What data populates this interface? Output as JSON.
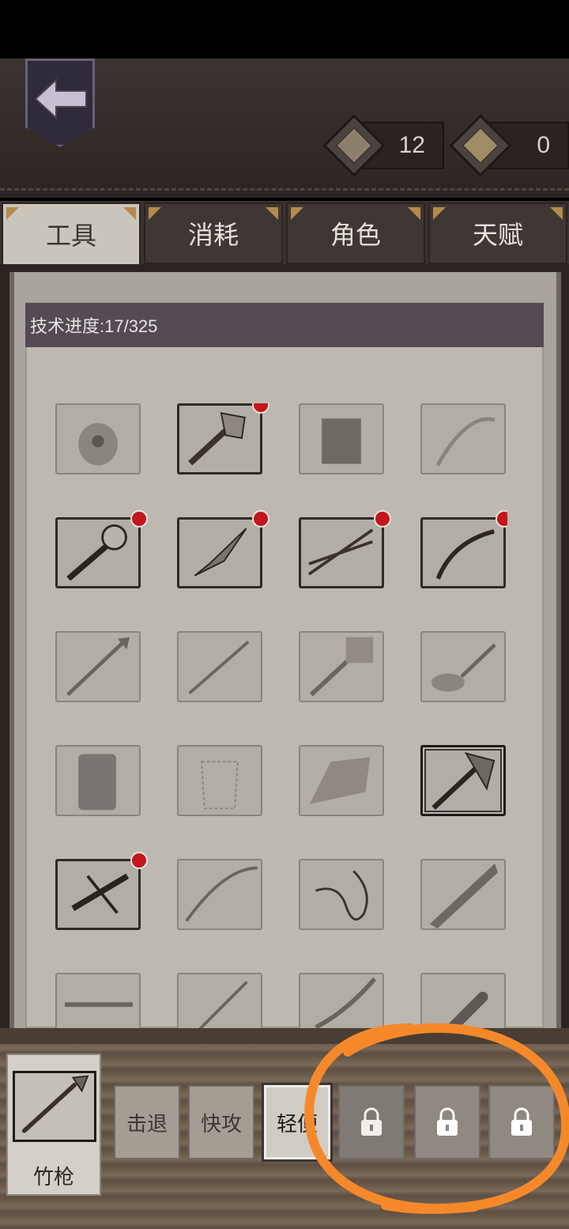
{
  "header": {
    "back_label": "",
    "currencies": [
      {
        "icon": "scroll-icon",
        "value": "12"
      },
      {
        "icon": "parchment-icon",
        "value": "0"
      }
    ]
  },
  "tabs": [
    {
      "label": "工具",
      "active": true
    },
    {
      "label": "消耗",
      "active": false
    },
    {
      "label": "角色",
      "active": false
    },
    {
      "label": "天赋",
      "active": false
    }
  ],
  "progress": {
    "text": "技术进度:17/325"
  },
  "items": [
    {
      "icon": "poison-pot-icon",
      "new": false,
      "owned": false
    },
    {
      "icon": "stone-axe-icon",
      "new": true,
      "owned": true
    },
    {
      "icon": "grass-skirt-icon",
      "new": false,
      "owned": false
    },
    {
      "icon": "bow-icon",
      "new": false,
      "owned": false
    },
    {
      "icon": "torch-icon",
      "new": true,
      "owned": true
    },
    {
      "icon": "stone-knife-icon",
      "new": true,
      "owned": true
    },
    {
      "icon": "arrows-icon",
      "new": true,
      "owned": true
    },
    {
      "icon": "recurve-bow-icon",
      "new": true,
      "owned": true
    },
    {
      "icon": "spear-icon",
      "new": false,
      "owned": false
    },
    {
      "icon": "long-spear-icon",
      "new": false,
      "owned": false
    },
    {
      "icon": "stone-hammer-icon",
      "new": false,
      "owned": false
    },
    {
      "icon": "frying-pan-icon",
      "new": false,
      "owned": false
    },
    {
      "icon": "leather-vest-icon",
      "new": false,
      "owned": false
    },
    {
      "icon": "shirt-outline-icon",
      "new": false,
      "owned": false
    },
    {
      "icon": "stone-block-icon",
      "new": false,
      "owned": false
    },
    {
      "icon": "battle-axe-icon",
      "new": false,
      "owned": true,
      "selected": true
    },
    {
      "icon": "crossbow-icon",
      "new": true,
      "owned": true
    },
    {
      "icon": "composite-bow-icon",
      "new": false,
      "owned": false
    },
    {
      "icon": "whip-icon",
      "new": false,
      "owned": false
    },
    {
      "icon": "serrated-sword-icon",
      "new": false,
      "owned": false
    },
    {
      "icon": "heavy-crossbow-icon",
      "new": false,
      "owned": false
    },
    {
      "icon": "broom-icon",
      "new": false,
      "owned": false
    },
    {
      "icon": "sword-icon",
      "new": false,
      "owned": false
    },
    {
      "icon": "club-icon",
      "new": false,
      "owned": false
    }
  ],
  "equipped": {
    "name": "竹枪",
    "icon": "bamboo-spear-icon"
  },
  "skills": [
    {
      "label": "击退",
      "state": "unlocked"
    },
    {
      "label": "快攻",
      "state": "unlocked"
    },
    {
      "label": "轻便",
      "state": "selected"
    },
    {
      "label": "",
      "state": "locked"
    },
    {
      "label": "",
      "state": "locked"
    },
    {
      "label": "",
      "state": "locked"
    }
  ],
  "colors": {
    "annotation": "#f5892a",
    "new_dot": "#c4161c",
    "progress_bar": "#544b55"
  }
}
